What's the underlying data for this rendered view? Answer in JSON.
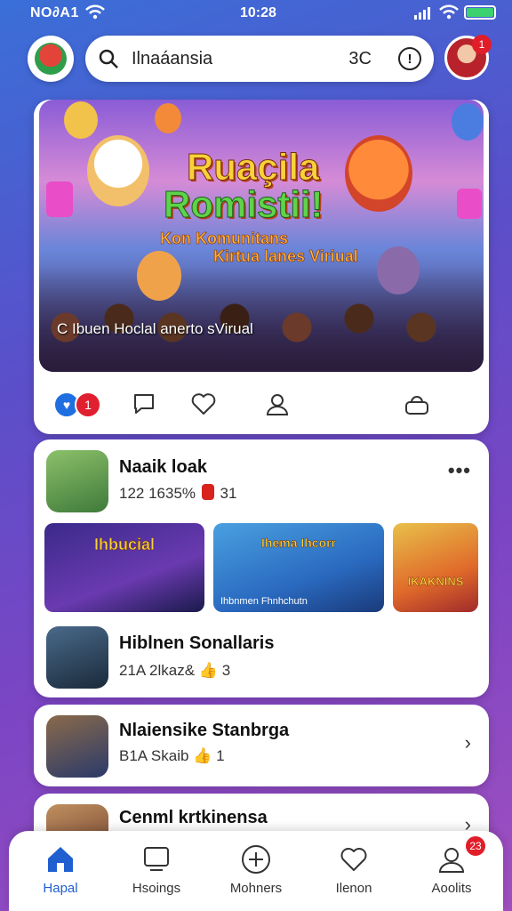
{
  "status": {
    "carrier": "NO∂A1",
    "time": "10:28"
  },
  "search": {
    "query": "Ilnaáansia",
    "shortcut": "3C",
    "info_symbol": "!"
  },
  "profile": {
    "badge": "1"
  },
  "hero": {
    "title_line1": "Ruaçila",
    "title_line2": "Romistii!",
    "subtitle_line1": "Kon Komunitans",
    "subtitle_line2": "Kirtua lanes Viriual",
    "caption": "C   Ibuen Hoclal anerto sVirual"
  },
  "actions": {
    "likes_count": "1"
  },
  "post1": {
    "name": "Naaik loak",
    "meta_left": "122 1635%",
    "meta_right": "31",
    "more": "•••",
    "thumbs": [
      {
        "title": "Ihbucial",
        "caption": ""
      },
      {
        "title": "Ihema Ihcorr",
        "caption": "Ihbnmen Fhnhchutn"
      },
      {
        "title": "",
        "caption": "",
        "title_small": "IKAKNINS"
      }
    ]
  },
  "post2": {
    "name": "Hiblnen Sonallaris",
    "meta": "21A 2lkaz&",
    "meta_count": "3"
  },
  "post3": {
    "name": "Nlaiensike Stanbrga",
    "meta": "B1A Skaib",
    "meta_count": "1"
  },
  "post4": {
    "name": "Cenml krtkinensa"
  },
  "tabs": [
    {
      "label": "Hapal",
      "icon": "home-icon",
      "active": true
    },
    {
      "label": "Hsoings",
      "icon": "tv-icon"
    },
    {
      "label": "Mohners",
      "icon": "plus-circle-icon"
    },
    {
      "label": "Ilenon",
      "icon": "heart-icon"
    },
    {
      "label": "Aoolits",
      "icon": "person-icon",
      "badge": "23"
    }
  ],
  "colors": {
    "accent": "#1f5fd0",
    "badge": "#e11d2a",
    "like_blue": "#1f6fe0"
  }
}
